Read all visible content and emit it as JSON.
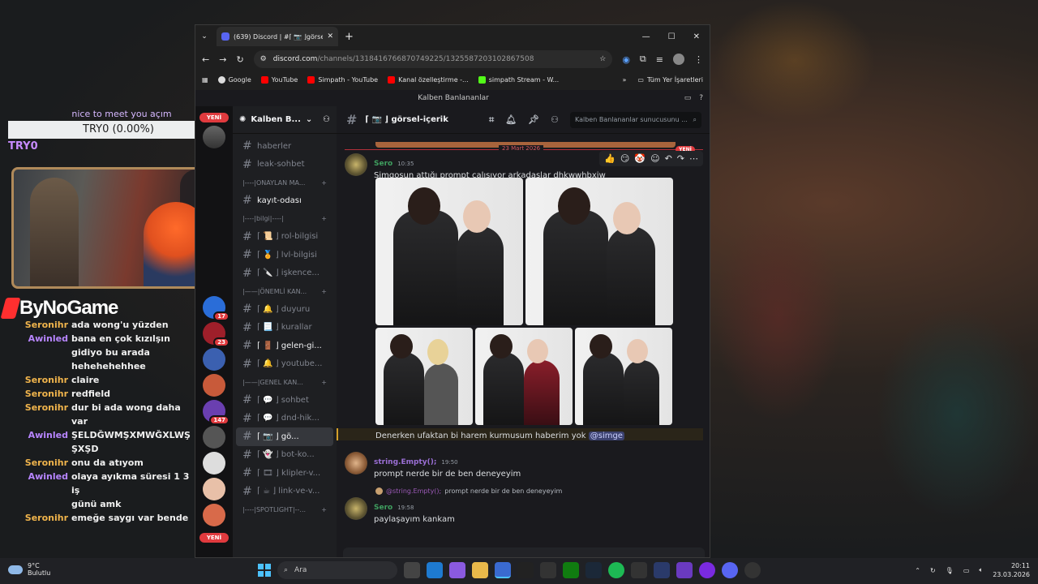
{
  "overlay": {
    "top_line": "nice to meet you açım",
    "bar_text": "TRY0 (0.00%)",
    "name": "TRY0",
    "brand": "ByNoGame"
  },
  "stream_chat": [
    {
      "user": "Seronihr",
      "msg": "ada wong'u yüzden",
      "kind": "ser"
    },
    {
      "user": "Awinled",
      "msg": "bana en çok kızılşın",
      "kind": "awi"
    },
    {
      "user": "",
      "msg": "gidiyo bu arada",
      "kind": "awi"
    },
    {
      "user": "",
      "msg": "hehehehehhee",
      "kind": "awi"
    },
    {
      "user": "Seronihr",
      "msg": "claire",
      "kind": "ser"
    },
    {
      "user": "Seronihr",
      "msg": "redfield",
      "kind": "ser"
    },
    {
      "user": "Seronihr",
      "msg": "dur bi ada wong daha var",
      "kind": "ser"
    },
    {
      "user": "Awinled",
      "msg": "ŞELDĞWMŞXMWĞXLWŞ",
      "kind": "awi"
    },
    {
      "user": "",
      "msg": "ŞXŞD",
      "kind": "awi"
    },
    {
      "user": "Seronihr",
      "msg": "onu da atıyom",
      "kind": "ser"
    },
    {
      "user": "Awinled",
      "msg": "olaya ayıkma süresi 1 3 iş",
      "kind": "awi"
    },
    {
      "user": "",
      "msg": "günü amk",
      "kind": "awi"
    },
    {
      "user": "Seronihr",
      "msg": "emeğe saygı var bende",
      "kind": "ser"
    }
  ],
  "browser": {
    "tab_title": "(639) Discord | #⌈ 📷 ⌋görsel-içe",
    "url_host": "discord.com",
    "url_path": "/channels/1318416766870749225/1325587203102867508",
    "bookmarks": [
      "Google",
      "YouTube",
      "Simpath - YouTube",
      "Kanal özelleştirme -...",
      "simpath Stream - W..."
    ],
    "bookmarks_all": "Tüm Yer İşaretleri"
  },
  "discord": {
    "window_title": "Kalben Banlananlar",
    "server_name": "Kalben B...",
    "badges": {
      "yeni": "YENİ",
      "b1": "17",
      "b2": "23",
      "b3": "147"
    },
    "channels": [
      {
        "name": "haberler",
        "type": "ch"
      },
      {
        "name": "leak-sohbet",
        "type": "ch"
      },
      {
        "name": "|----|ONAYLAN MA...",
        "type": "cat"
      },
      {
        "name": "kayıt-odası",
        "type": "ch",
        "bright": true
      },
      {
        "name": "|----|bilgi|----|",
        "type": "cat"
      },
      {
        "name": "⌈ 📜 ⌋ rol-bilgisi",
        "type": "ch"
      },
      {
        "name": "⌈ 🏅 ⌋ lvl-bilgisi",
        "type": "ch"
      },
      {
        "name": "⌈ 🔪 ⌋ işkence...",
        "type": "ch"
      },
      {
        "name": "|——|ÖNEMLİ KAN...",
        "type": "cat"
      },
      {
        "name": "⌈ 🔔 ⌋ duyuru",
        "type": "ch"
      },
      {
        "name": "⌈ 📃 ⌋ kurallar",
        "type": "ch"
      },
      {
        "name": "⌈ 🚪 ⌋ gelen-gi...",
        "type": "ch",
        "bright": true
      },
      {
        "name": "⌈ 🔔 ⌋ youtube...",
        "type": "ch"
      },
      {
        "name": "|——|GENEL KAN...",
        "type": "cat"
      },
      {
        "name": "⌈ 💬 ⌋ sohbet",
        "type": "ch"
      },
      {
        "name": "⌈ 💬 ⌋ dnd-hik...",
        "type": "ch"
      },
      {
        "name": "⌈ 📷 ⌋ gö...",
        "type": "ch",
        "active": true
      },
      {
        "name": "⌈ 👻 ⌋ bot-ko...",
        "type": "ch"
      },
      {
        "name": "⌈ 🎞 ⌋ klipler-v...",
        "type": "ch"
      },
      {
        "name": "⌈ ☕ ⌋ link-ve-v...",
        "type": "ch"
      },
      {
        "name": "|----|SPOTLIGHT|--...",
        "type": "cat"
      }
    ],
    "channel_title": "⌈ 📷 ⌋ görsel-içerik",
    "search_placeholder": "Kalben Banlananlar sunucusunu ...",
    "date_divider": "23 Mart 2026",
    "new_label": "YENİ",
    "messages": {
      "m1_author": "Sero",
      "m1_time": "10:35",
      "m1_text": "Simgoşun attığı prompt çalışıyor arkadaşlar dhkwwhbxjw",
      "m1_followup": "Denerken ufaktan bi harem kurmusum haberim yok",
      "m1_mention": "@simge",
      "m2_author": "string.Empty();",
      "m2_time": "19:50",
      "m2_text": "prompt nerde bir de ben deneyeyim",
      "reply_user": "@string.Empty();",
      "reply_text": "prompt nerde bir de ben deneyeyim",
      "m3_author": "Sero",
      "m3_time": "19:58",
      "m3_text": "paylaşayım kankam"
    },
    "colors": {
      "sero": "#3f9f5f",
      "string": "#9b6fd6"
    }
  },
  "taskbar": {
    "temp": "9°C",
    "weather": "Bulutlu",
    "search": "Ara",
    "time": "20:11",
    "date": "23.03.2026"
  }
}
